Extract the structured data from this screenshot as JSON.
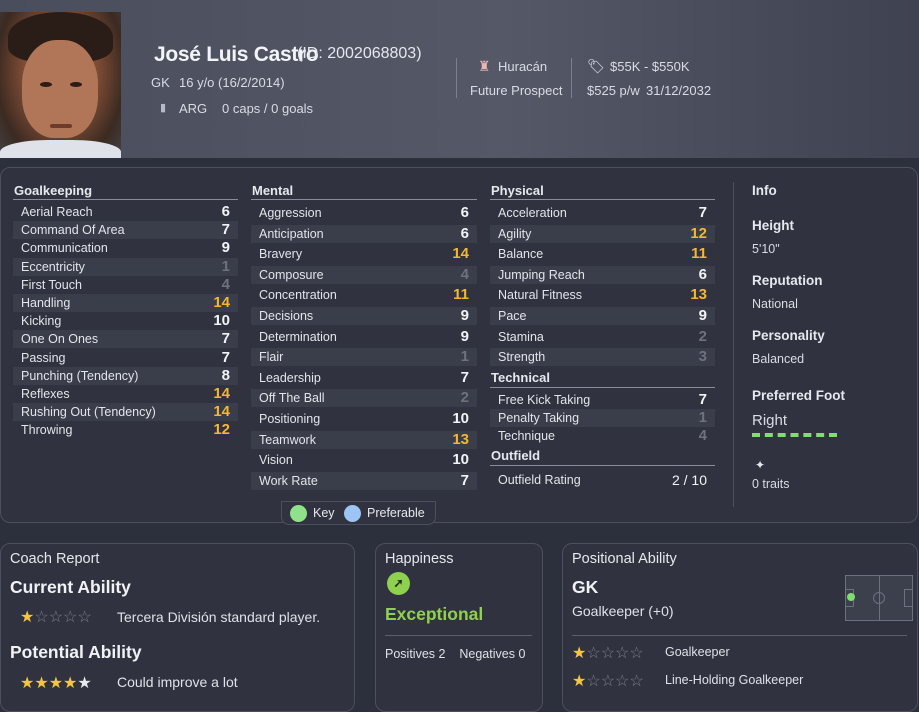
{
  "player": {
    "name": "José Luis Castro",
    "id_text": "(ID: 2002068803)",
    "position": "GK",
    "age_text": "16 y/o (16/2/2014)",
    "nation": "ARG",
    "caps_goals": "0 caps / 0 goals",
    "club": "Huracán",
    "status": "Future Prospect",
    "value_range": "$55K - $550K",
    "wage": "$525 p/w",
    "contract_end": "31/12/2032"
  },
  "goalkeeping": {
    "title": "Goalkeeping",
    "attributes": [
      {
        "name": "Aerial Reach",
        "value": "6"
      },
      {
        "name": "Command Of Area",
        "value": "7"
      },
      {
        "name": "Communication",
        "value": "9"
      },
      {
        "name": "Eccentricity",
        "value": "1"
      },
      {
        "name": "First Touch",
        "value": "4"
      },
      {
        "name": "Handling",
        "value": "14"
      },
      {
        "name": "Kicking",
        "value": "10"
      },
      {
        "name": "One On Ones",
        "value": "7"
      },
      {
        "name": "Passing",
        "value": "7"
      },
      {
        "name": "Punching (Tendency)",
        "value": "8"
      },
      {
        "name": "Reflexes",
        "value": "14"
      },
      {
        "name": "Rushing Out (Tendency)",
        "value": "14"
      },
      {
        "name": "Throwing",
        "value": "12"
      }
    ]
  },
  "mental": {
    "title": "Mental",
    "attributes": [
      {
        "name": "Aggression",
        "value": "6"
      },
      {
        "name": "Anticipation",
        "value": "6"
      },
      {
        "name": "Bravery",
        "value": "14"
      },
      {
        "name": "Composure",
        "value": "4"
      },
      {
        "name": "Concentration",
        "value": "11"
      },
      {
        "name": "Decisions",
        "value": "9"
      },
      {
        "name": "Determination",
        "value": "9"
      },
      {
        "name": "Flair",
        "value": "1"
      },
      {
        "name": "Leadership",
        "value": "7"
      },
      {
        "name": "Off The Ball",
        "value": "2"
      },
      {
        "name": "Positioning",
        "value": "10"
      },
      {
        "name": "Teamwork",
        "value": "13"
      },
      {
        "name": "Vision",
        "value": "10"
      },
      {
        "name": "Work Rate",
        "value": "7"
      }
    ]
  },
  "physical": {
    "title": "Physical",
    "attributes": [
      {
        "name": "Acceleration",
        "value": "7"
      },
      {
        "name": "Agility",
        "value": "12"
      },
      {
        "name": "Balance",
        "value": "11"
      },
      {
        "name": "Jumping Reach",
        "value": "6"
      },
      {
        "name": "Natural Fitness",
        "value": "13"
      },
      {
        "name": "Pace",
        "value": "9"
      },
      {
        "name": "Stamina",
        "value": "2"
      },
      {
        "name": "Strength",
        "value": "3"
      }
    ]
  },
  "technical": {
    "title": "Technical",
    "attributes": [
      {
        "name": "Free Kick Taking",
        "value": "7"
      },
      {
        "name": "Penalty Taking",
        "value": "1"
      },
      {
        "name": "Technique",
        "value": "4"
      }
    ]
  },
  "outfield": {
    "title": "Outfield",
    "rating_label": "Outfield Rating",
    "rating_value": "2 / 10"
  },
  "info": {
    "title": "Info",
    "height_label": "Height",
    "height_value": "5'10\"",
    "reputation_label": "Reputation",
    "reputation_value": "National",
    "personality_label": "Personality",
    "personality_value": "Balanced",
    "foot_label": "Preferred Foot",
    "foot_value": "Right",
    "traits_text": "0 traits"
  },
  "legend": {
    "key_label": "Key",
    "preferable_label": "Preferable",
    "key_color": "#90e28a",
    "preferable_color": "#9cc4f5"
  },
  "coach_report": {
    "title": "Coach Report",
    "current_title": "Current Ability",
    "current_stars": 1,
    "current_text": "Tercera División standard player.",
    "potential_title": "Potential Ability",
    "potential_stars": 4,
    "potential_text": "Could improve a lot"
  },
  "happiness": {
    "title": "Happiness",
    "level": "Exceptional",
    "positives_label": "Positives",
    "positives_count": "2",
    "negatives_label": "Negatives",
    "negatives_count": "0",
    "accent": "#8fd14f"
  },
  "positional": {
    "title": "Positional Ability",
    "main_position": "GK",
    "position_desc": "Goalkeeper (+0)",
    "roles": [
      {
        "name": "Goalkeeper",
        "stars": 1
      },
      {
        "name": "Line-Holding Goalkeeper",
        "stars": 1
      }
    ]
  },
  "colors": {
    "highlight": "#f5b731",
    "low": "#6e7180",
    "foot_bar": "#7ee06a"
  }
}
